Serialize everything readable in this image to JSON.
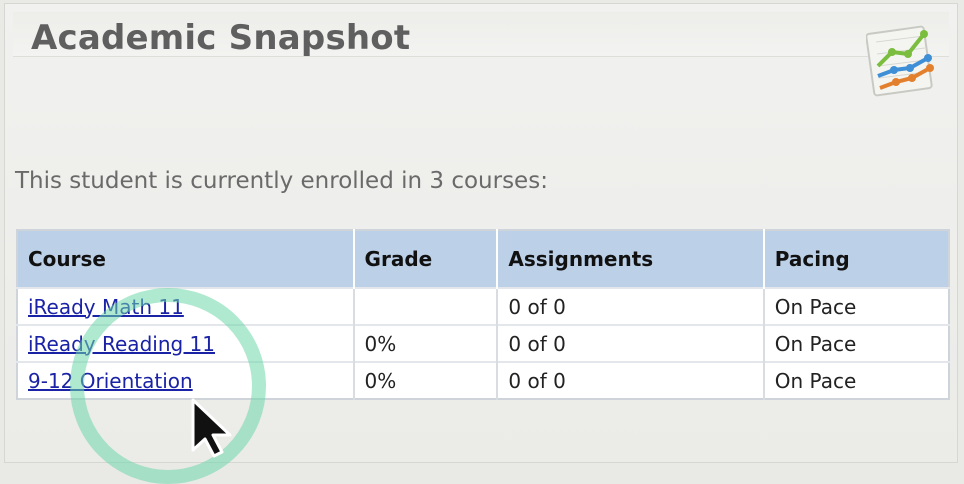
{
  "panel": {
    "title": "Academic Snapshot",
    "chart_icon": "line-chart-icon",
    "enrollment_text": "This student is currently enrolled in 3 courses:"
  },
  "table": {
    "headers": {
      "course": "Course",
      "grade": "Grade",
      "assignments": "Assignments",
      "pacing": "Pacing"
    },
    "rows": [
      {
        "course": "iReady Math 11",
        "grade": "",
        "assignments": "0 of 0",
        "pacing": "On Pace"
      },
      {
        "course": "iReady Reading 11",
        "grade": "0%",
        "assignments": "0 of 0",
        "pacing": "On Pace"
      },
      {
        "course": "9-12 Orientation",
        "grade": "0%",
        "assignments": "0 of 0",
        "pacing": "On Pace"
      }
    ]
  },
  "colors": {
    "header_bg": "#bcd0e8",
    "link": "#1a22a6",
    "click_ring": "#6ed7aa"
  },
  "cursor_icon": "mouse-pointer-icon",
  "click_indicator": "click-ring-indicator"
}
